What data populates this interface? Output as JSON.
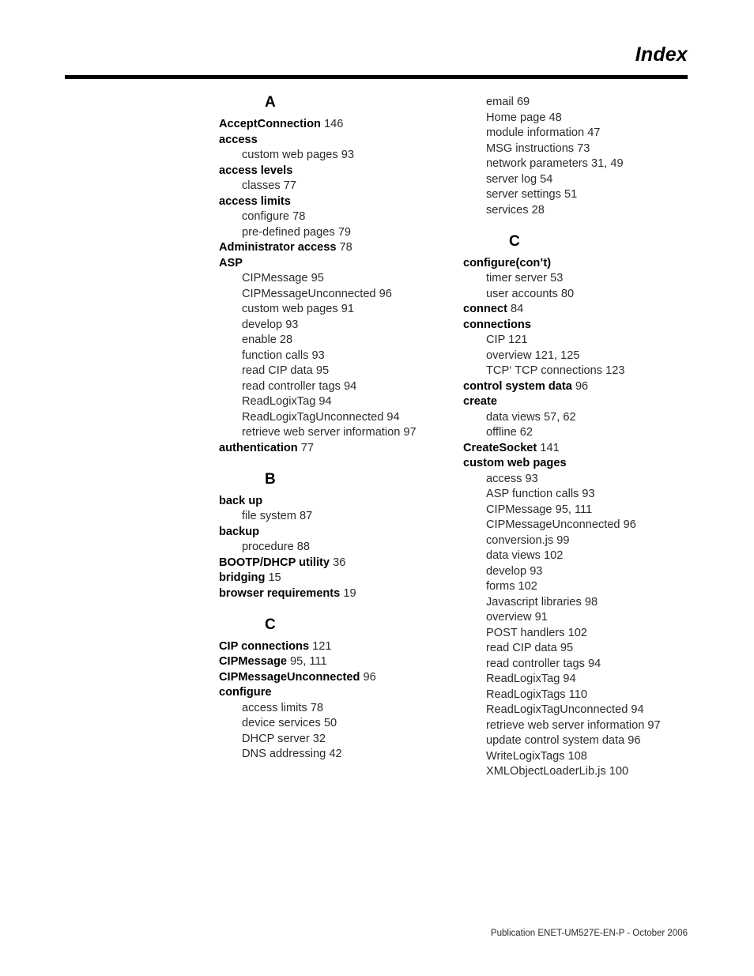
{
  "header": {
    "title": "Index"
  },
  "footer": {
    "publication": "Publication ENET-UM527E-EN-P - October 2006"
  },
  "columns": [
    {
      "name": "left",
      "blocks": [
        {
          "letter": "A",
          "entries": [
            {
              "term": "AcceptConnection",
              "pages": "146",
              "sub": []
            },
            {
              "term": "access",
              "pages": "",
              "sub": [
                {
                  "term": "custom web pages",
                  "pages": "93"
                }
              ]
            },
            {
              "term": "access levels",
              "pages": "",
              "sub": [
                {
                  "term": "classes",
                  "pages": "77"
                }
              ]
            },
            {
              "term": "access limits",
              "pages": "",
              "sub": [
                {
                  "term": "configure",
                  "pages": "78"
                },
                {
                  "term": "pre-defined pages",
                  "pages": "79"
                }
              ]
            },
            {
              "term": "Administrator access",
              "pages": "78",
              "sub": []
            },
            {
              "term": "ASP",
              "pages": "",
              "sub": [
                {
                  "term": "CIPMessage",
                  "pages": "95"
                },
                {
                  "term": "CIPMessageUnconnected",
                  "pages": "96"
                },
                {
                  "term": "custom web pages",
                  "pages": "91"
                },
                {
                  "term": "develop",
                  "pages": "93"
                },
                {
                  "term": "enable",
                  "pages": "28"
                },
                {
                  "term": "function calls",
                  "pages": "93"
                },
                {
                  "term": "read CIP data",
                  "pages": "95"
                },
                {
                  "term": "read controller tags",
                  "pages": "94"
                },
                {
                  "term": "ReadLogixTag",
                  "pages": "94"
                },
                {
                  "term": "ReadLogixTagUnconnected",
                  "pages": "94"
                },
                {
                  "term": "retrieve web server information",
                  "pages": "97"
                }
              ]
            },
            {
              "term": "authentication",
              "pages": "77",
              "sub": []
            }
          ]
        },
        {
          "letter": "B",
          "entries": [
            {
              "term": "back up",
              "pages": "",
              "sub": [
                {
                  "term": "file system",
                  "pages": "87"
                }
              ]
            },
            {
              "term": "backup",
              "pages": "",
              "sub": [
                {
                  "term": "procedure",
                  "pages": "88"
                }
              ]
            },
            {
              "term": "BOOTP/DHCP utility",
              "pages": "36",
              "sub": []
            },
            {
              "term": "bridging",
              "pages": "15",
              "sub": []
            },
            {
              "term": "browser requirements",
              "pages": "19",
              "sub": []
            }
          ]
        },
        {
          "letter": "C",
          "entries": [
            {
              "term": "CIP connections",
              "pages": "121",
              "sub": []
            },
            {
              "term": "CIPMessage",
              "pages": "95, 111",
              "sub": []
            },
            {
              "term": "CIPMessageUnconnected",
              "pages": "96",
              "sub": []
            },
            {
              "term": "configure",
              "pages": "",
              "sub": [
                {
                  "term": "access limits",
                  "pages": "78"
                },
                {
                  "term": "device services",
                  "pages": "50"
                },
                {
                  "term": "DHCP server",
                  "pages": "32"
                },
                {
                  "term": "DNS addressing",
                  "pages": "42"
                }
              ]
            }
          ]
        }
      ]
    },
    {
      "name": "right",
      "blocks": [
        {
          "letter": "",
          "entries": [
            {
              "term": "",
              "pages": "",
              "sub": [
                {
                  "term": "email",
                  "pages": "69"
                },
                {
                  "term": "Home page",
                  "pages": "48"
                },
                {
                  "term": "module information",
                  "pages": "47"
                },
                {
                  "term": "MSG instructions",
                  "pages": "73"
                },
                {
                  "term": "network parameters",
                  "pages": "31, 49"
                },
                {
                  "term": "server log",
                  "pages": "54"
                },
                {
                  "term": "server settings",
                  "pages": "51"
                },
                {
                  "term": "services",
                  "pages": "28"
                }
              ]
            }
          ]
        },
        {
          "letter": "C",
          "entries": [
            {
              "term": "configure(con’t)",
              "pages": "",
              "sub": [
                {
                  "term": "timer server",
                  "pages": "53"
                },
                {
                  "term": "user accounts",
                  "pages": "80"
                }
              ]
            },
            {
              "term": "connect",
              "pages": "84",
              "sub": []
            },
            {
              "term": "connections",
              "pages": "",
              "sub": [
                {
                  "term": "CIP",
                  "pages": "121"
                },
                {
                  "term": "overview",
                  "pages": "121, 125"
                },
                {
                  "term": "TCP‘ TCP connections",
                  "pages": "123"
                }
              ]
            },
            {
              "term": "control system data",
              "pages": "96",
              "sub": []
            },
            {
              "term": "create",
              "pages": "",
              "sub": [
                {
                  "term": "data views",
                  "pages": "57, 62"
                },
                {
                  "term": "offline",
                  "pages": "62"
                }
              ]
            },
            {
              "term": "CreateSocket",
              "pages": "141",
              "sub": []
            },
            {
              "term": "custom web pages",
              "pages": "",
              "sub": [
                {
                  "term": "access",
                  "pages": "93"
                },
                {
                  "term": "ASP function calls",
                  "pages": "93"
                },
                {
                  "term": "CIPMessage",
                  "pages": "95, 111"
                },
                {
                  "term": "CIPMessageUnconnected",
                  "pages": "96"
                },
                {
                  "term": "conversion.js",
                  "pages": "99"
                },
                {
                  "term": "data views",
                  "pages": "102"
                },
                {
                  "term": "develop",
                  "pages": "93"
                },
                {
                  "term": "forms",
                  "pages": "102"
                },
                {
                  "term": "Javascript libraries",
                  "pages": "98"
                },
                {
                  "term": "overview",
                  "pages": "91"
                },
                {
                  "term": "POST handlers",
                  "pages": "102"
                },
                {
                  "term": "read CIP data",
                  "pages": "95"
                },
                {
                  "term": "read controller tags",
                  "pages": "94"
                },
                {
                  "term": "ReadLogixTag",
                  "pages": "94"
                },
                {
                  "term": "ReadLogixTags",
                  "pages": "110"
                },
                {
                  "term": "ReadLogixTagUnconnected",
                  "pages": "94"
                },
                {
                  "term": "retrieve web server information",
                  "pages": "97"
                },
                {
                  "term": "update control system data",
                  "pages": "96"
                },
                {
                  "term": "WriteLogixTags",
                  "pages": "108"
                },
                {
                  "term": "XMLObjectLoaderLib.js",
                  "pages": "100"
                }
              ]
            }
          ]
        }
      ]
    }
  ]
}
